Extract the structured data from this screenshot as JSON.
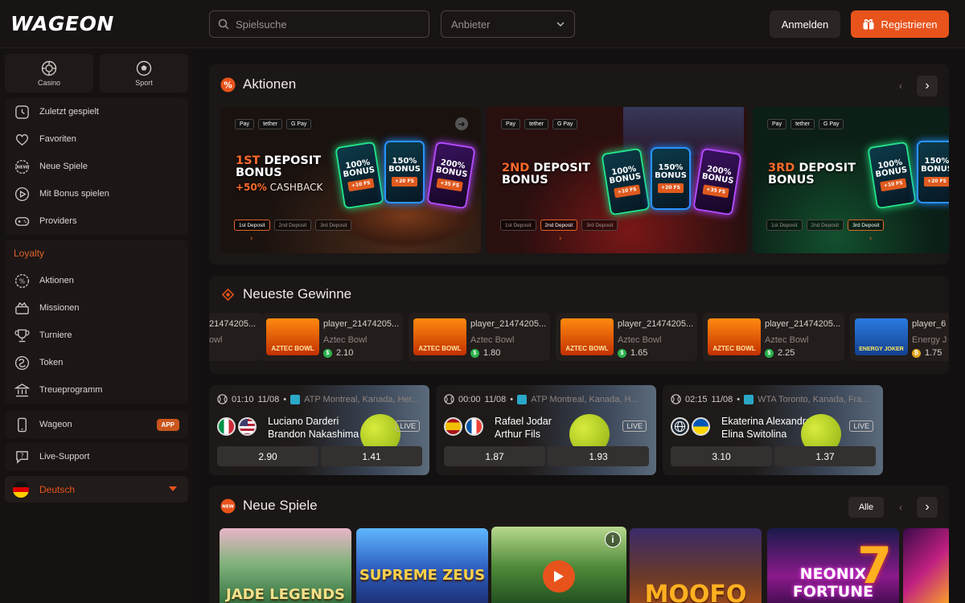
{
  "header": {
    "logo": "WAGEON",
    "search_placeholder": "Spielsuche",
    "provider_label": "Anbieter",
    "login_label": "Anmelden",
    "register_label": "Registrieren"
  },
  "sidebar": {
    "mode_tabs": [
      {
        "label": "Casino",
        "icon": "casino-chip-icon"
      },
      {
        "label": "Sport",
        "icon": "soccer-ball-icon"
      }
    ],
    "nav": [
      {
        "label": "Zuletzt gespielt",
        "icon": "recent-icon"
      },
      {
        "label": "Favoriten",
        "icon": "heart-icon"
      },
      {
        "label": "Neue Spiele",
        "icon": "new-badge-icon"
      },
      {
        "label": "Mit Bonus spielen",
        "icon": "play-bonus-icon"
      },
      {
        "label": "Providers",
        "icon": "gamepad-icon"
      }
    ],
    "loyalty_heading": "Loyalty",
    "loyalty": [
      {
        "label": "Aktionen",
        "icon": "promo-icon"
      },
      {
        "label": "Missionen",
        "icon": "missions-icon"
      },
      {
        "label": "Turniere",
        "icon": "trophy-icon"
      },
      {
        "label": "Token",
        "icon": "token-icon"
      },
      {
        "label": "Treueprogramm",
        "icon": "loyalty-program-icon"
      }
    ],
    "app_label": "Wageon",
    "app_badge": "APP",
    "support_label": "Live-Support",
    "language": "Deutsch"
  },
  "promotions": {
    "title": "Aktionen",
    "pay_methods": [
      "Pay",
      "tether",
      "G Pay"
    ],
    "steps": [
      "1st Deposit",
      "2nd Deposit",
      "3rd Deposit"
    ],
    "cards": [
      {
        "line1": "1ST",
        "line1_rest": "DEPOSIT",
        "line2": "BONUS",
        "sub_hl": "+50%",
        "sub": "CASHBACK",
        "bonuses": [
          {
            "pct": "100%",
            "word": "BONUS",
            "fs": "+10 FS"
          },
          {
            "pct": "150%",
            "word": "BONUS",
            "fs": "+20 FS"
          },
          {
            "pct": "200%",
            "word": "BONUS",
            "fs": "+35 FS"
          }
        ]
      },
      {
        "line1": "2ND",
        "line1_rest": "DEPOSIT",
        "line2": "BONUS",
        "bonuses": [
          {
            "pct": "100%",
            "word": "BONUS",
            "fs": "+10 FS"
          },
          {
            "pct": "150%",
            "word": "BONUS",
            "fs": "+20 FS"
          },
          {
            "pct": "200%",
            "word": "BONUS",
            "fs": "+35 FS"
          }
        ]
      },
      {
        "line1": "3RD",
        "line1_rest": "DEPOSIT",
        "line2": "BONUS",
        "bonuses": [
          {
            "pct": "100%",
            "word": "BONUS",
            "fs": "+10 FS"
          },
          {
            "pct": "150%",
            "word": "BONUS",
            "fs": "+20 FS"
          }
        ]
      }
    ]
  },
  "winners": {
    "title": "Neueste Gewinne",
    "items": [
      {
        "player": "player_21474205...",
        "game": "Aztec Bowl",
        "amount": "2.10",
        "thumb_text": "AZTEC BOWL"
      },
      {
        "player": "player_21474205...",
        "game": "Aztec Bowl",
        "amount": "1.80",
        "thumb_text": "AZTEC BOWL"
      },
      {
        "player": "player_21474205...",
        "game": "Aztec Bowl",
        "amount": "1.65",
        "thumb_text": "AZTEC BOWL"
      },
      {
        "player": "player_21474205...",
        "game": "Aztec Bowl",
        "amount": "2.25",
        "thumb_text": "AZTEC BOWL"
      }
    ],
    "partial_left_player": "21474205...",
    "partial_left_game": "owl",
    "partial_right_player": "player_6",
    "partial_right_game": "Energy J",
    "partial_right_amount": "1.75",
    "partial_right_thumb": "ENERGY JOKER"
  },
  "matches": [
    {
      "time": "01:10",
      "date": "11/08",
      "league": "ATP Montreal, Kanada, Her...",
      "p1": "Luciano Darderi",
      "p2": "Brandon Nakashima",
      "live": "LIVE",
      "odd1": "2.90",
      "odd2": "1.41"
    },
    {
      "time": "00:00",
      "date": "11/08",
      "league": "ATP Montreal, Kanada, H...",
      "p1": "Rafael Jodar",
      "p2": "Arthur Fils",
      "live": "LIVE",
      "odd1": "1.87",
      "odd2": "1.93"
    },
    {
      "time": "02:15",
      "date": "11/08",
      "league": "WTA Toronto, Kanada, Fra...",
      "p1": "Ekaterina Alexandrova",
      "p2": "Elina Switolina",
      "live": "LIVE",
      "odd1": "3.10",
      "odd2": "1.37"
    }
  ],
  "new_games": {
    "title": "Neue Spiele",
    "all_label": "Alle",
    "games": [
      {
        "title": "JADE LEGENDS"
      },
      {
        "title": "SUPREME ZEUS"
      },
      {
        "title": ""
      },
      {
        "title": "MOOFO"
      },
      {
        "title": "NEONIX FORTUNE"
      },
      {
        "title": ""
      }
    ]
  }
}
